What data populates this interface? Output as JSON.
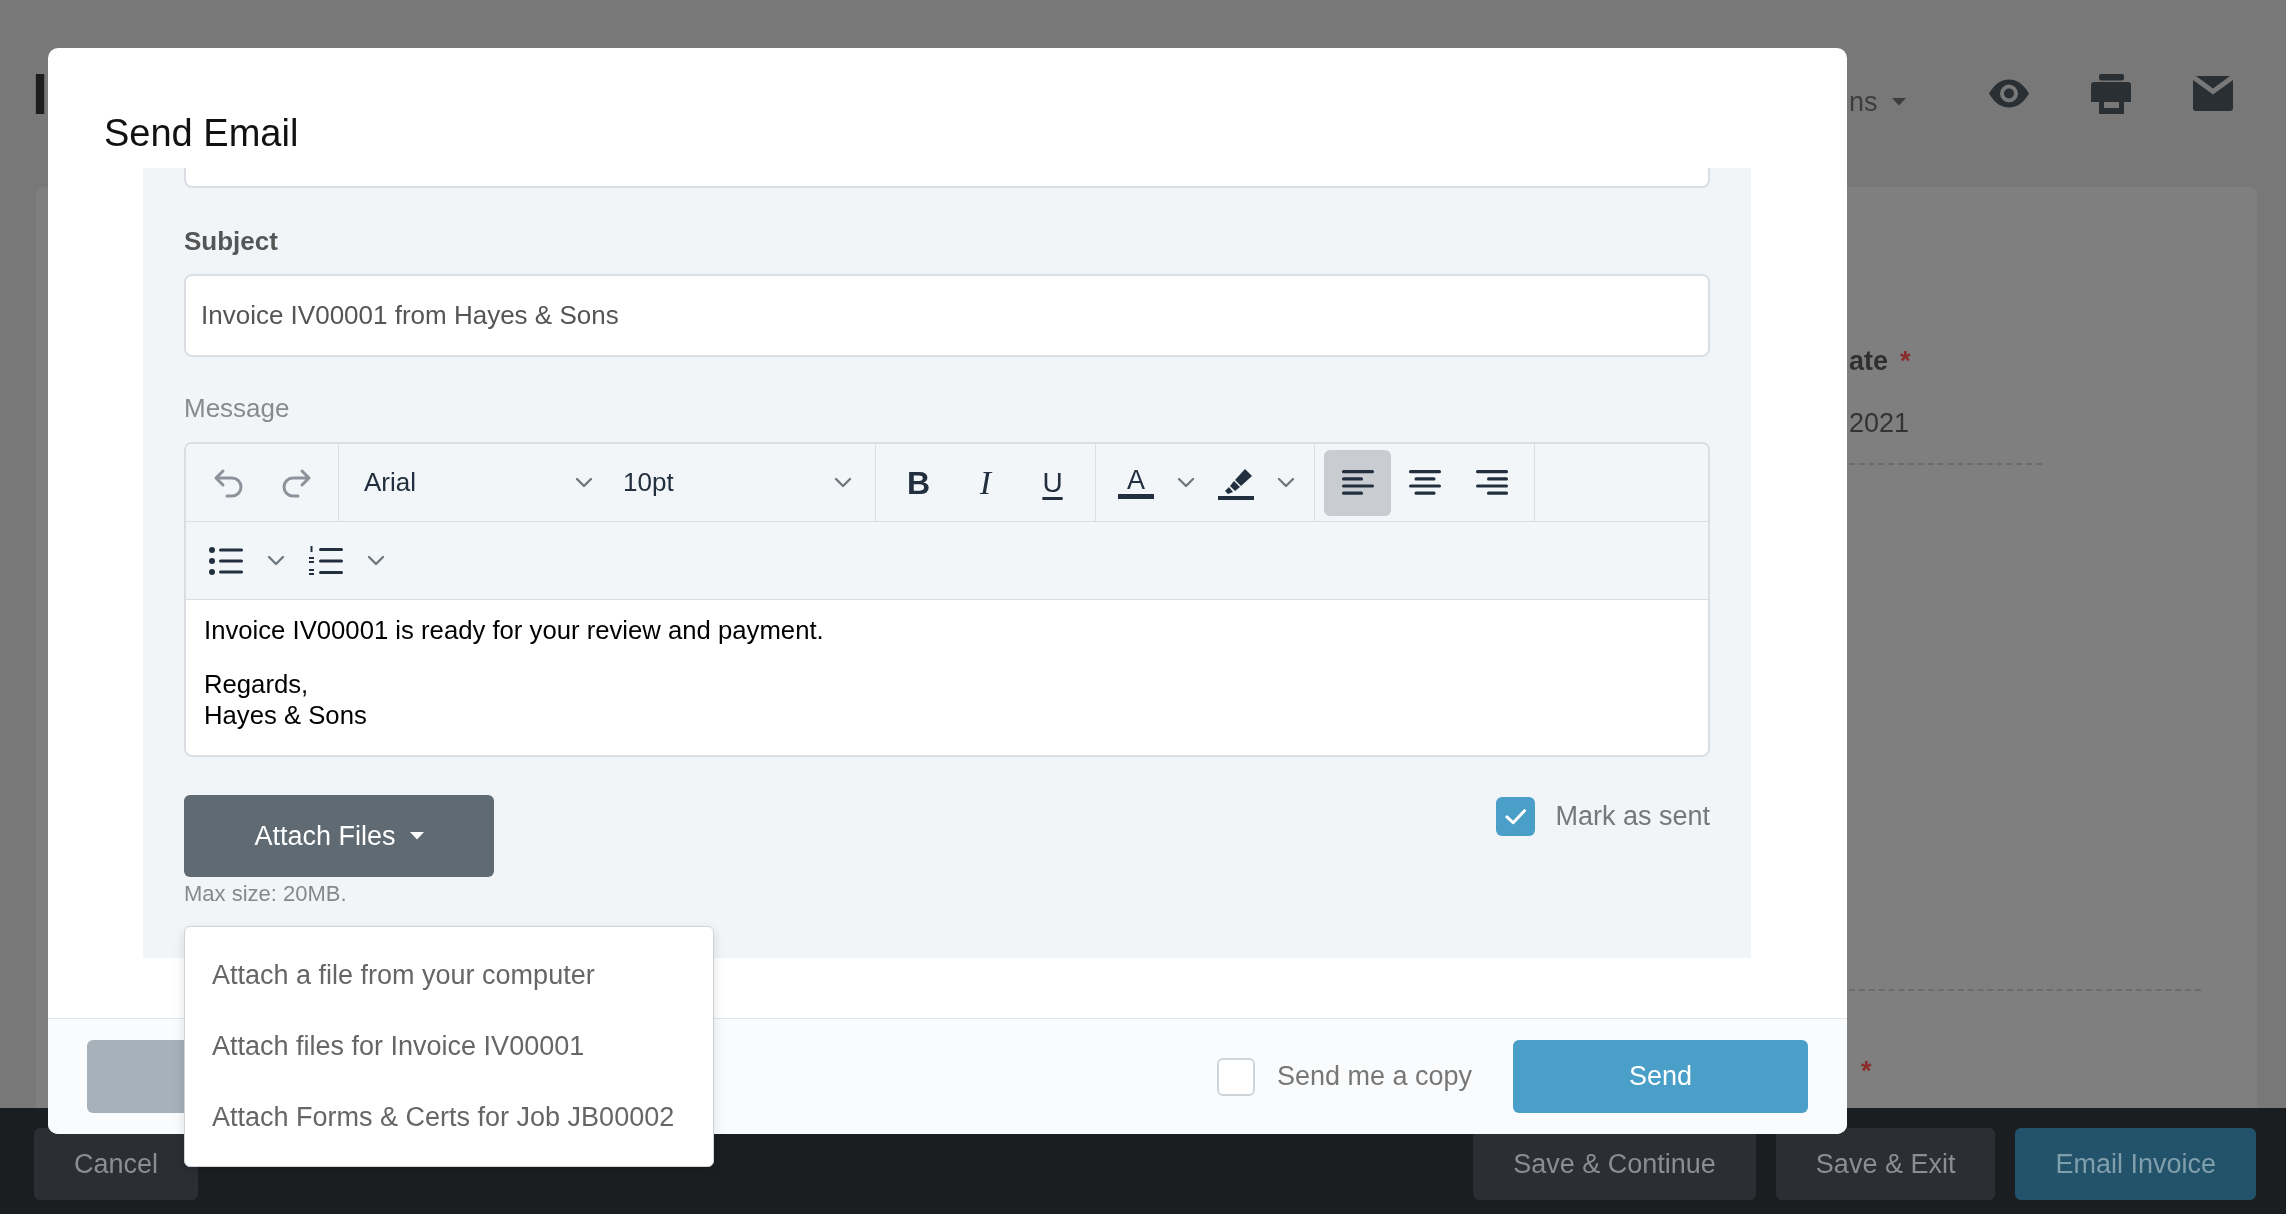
{
  "page": {
    "title": "I",
    "options_menu": "ns",
    "fields": [
      {
        "label": "ate",
        "required_mark": "*",
        "value": "2021"
      },
      {
        "required_mark": "*"
      }
    ]
  },
  "dialog": {
    "title": "Send Email",
    "subject": {
      "label": "Subject",
      "value": "Invoice IV00001 from Hayes & Sons"
    },
    "message": {
      "label": "Message",
      "toolbar": [
        {
          "groups": [
            {
              "items": [
                {
                  "kind": "undo",
                  "disabled": true
                },
                {
                  "kind": "redo",
                  "disabled": true
                }
              ]
            },
            {
              "items": [
                {
                  "kind": "font_family",
                  "value": "Arial"
                },
                {
                  "kind": "font_size",
                  "value": "10pt"
                }
              ]
            },
            {
              "items": [
                {
                  "kind": "bold",
                  "label": "B"
                },
                {
                  "kind": "italic",
                  "label": "I"
                },
                {
                  "kind": "underline",
                  "label": "U"
                }
              ]
            },
            {
              "items": [
                {
                  "kind": "text_color",
                  "label": "A"
                },
                {
                  "kind": "highlight"
                }
              ]
            },
            {
              "items": [
                {
                  "kind": "align_left",
                  "selected": true
                },
                {
                  "kind": "align_center",
                  "selected": false
                },
                {
                  "kind": "align_right",
                  "selected": false
                }
              ]
            }
          ]
        },
        {
          "groups": [
            {
              "items": [
                {
                  "kind": "bullet_list"
                },
                {
                  "kind": "numbered_list"
                }
              ]
            }
          ]
        }
      ],
      "paragraphs": [
        [
          "Invoice IV00001 is ready for your review and payment."
        ],
        [
          "Regards,",
          "Hayes & Sons"
        ]
      ]
    },
    "attach": {
      "label": "Attach Files",
      "hint": "Max size: 20MB.",
      "expanded": true,
      "menu": [
        "Attach a file from your computer",
        "Attach files for Invoice IV00001",
        "Attach Forms & Certs for Job JB00002"
      ]
    },
    "mark_as_sent": {
      "label": "Mark as sent",
      "checked": true
    },
    "footer": {
      "send_copy": {
        "label": "Send me a copy",
        "checked": false
      },
      "buttons": [
        {
          "kind": "secondary"
        },
        {
          "kind": "primary",
          "label": "Send"
        }
      ]
    }
  },
  "bottom_bar": {
    "left_buttons": [
      {
        "kind": "secondary",
        "label": "Cancel"
      }
    ],
    "right_buttons": [
      {
        "kind": "secondary",
        "label": "Save & Continue"
      },
      {
        "kind": "secondary",
        "label": "Save & Exit"
      },
      {
        "kind": "primary",
        "label": "Email Invoice"
      }
    ]
  }
}
